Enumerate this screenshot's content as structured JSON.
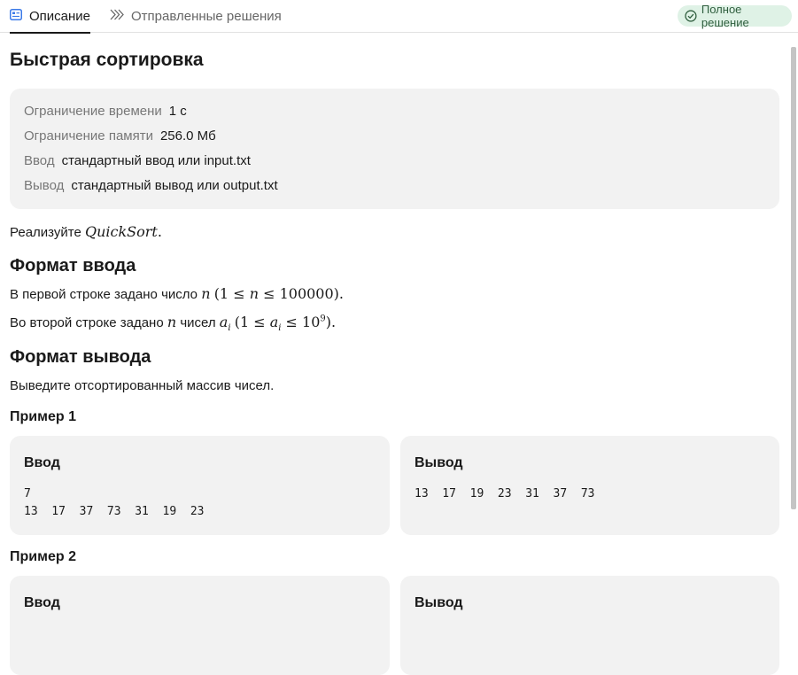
{
  "tabs": {
    "description": "Описание",
    "submissions": "Отправленные решения"
  },
  "status_badge": "Полное решение",
  "problem": {
    "title": "Быстрая сортировка",
    "limits": [
      {
        "label": "Ограничение времени",
        "value": "1 с"
      },
      {
        "label": "Ограничение памяти",
        "value": "256.0 Мб"
      },
      {
        "label": "Ввод",
        "value": "стандартный ввод или input.txt"
      },
      {
        "label": "Вывод",
        "value": "стандартный вывод или output.txt"
      }
    ],
    "statement_prefix": "Реализуйте ",
    "statement_math": "QuickSort",
    "input_format_title": "Формат ввода",
    "input_line1_text": "В первой строке задано число ",
    "input_line2_text_a": "Во второй строке задано ",
    "input_line2_text_b": " чисел ",
    "output_format_title": "Формат вывода",
    "output_text": "Выведите отсортированный массив чисел."
  },
  "examples": [
    {
      "title": "Пример 1",
      "input_label": "Ввод",
      "input": "7\n13  17  37  73  31  19  23",
      "output_label": "Вывод",
      "output": "13  17  19  23  31  37  73"
    },
    {
      "title": "Пример 2",
      "input_label": "Ввод",
      "output_label": "Вывод"
    }
  ],
  "colors": {
    "badge_bg": "#dff2e6",
    "card_bg": "#f2f2f2",
    "accent_icon": "#3b7ae8"
  }
}
